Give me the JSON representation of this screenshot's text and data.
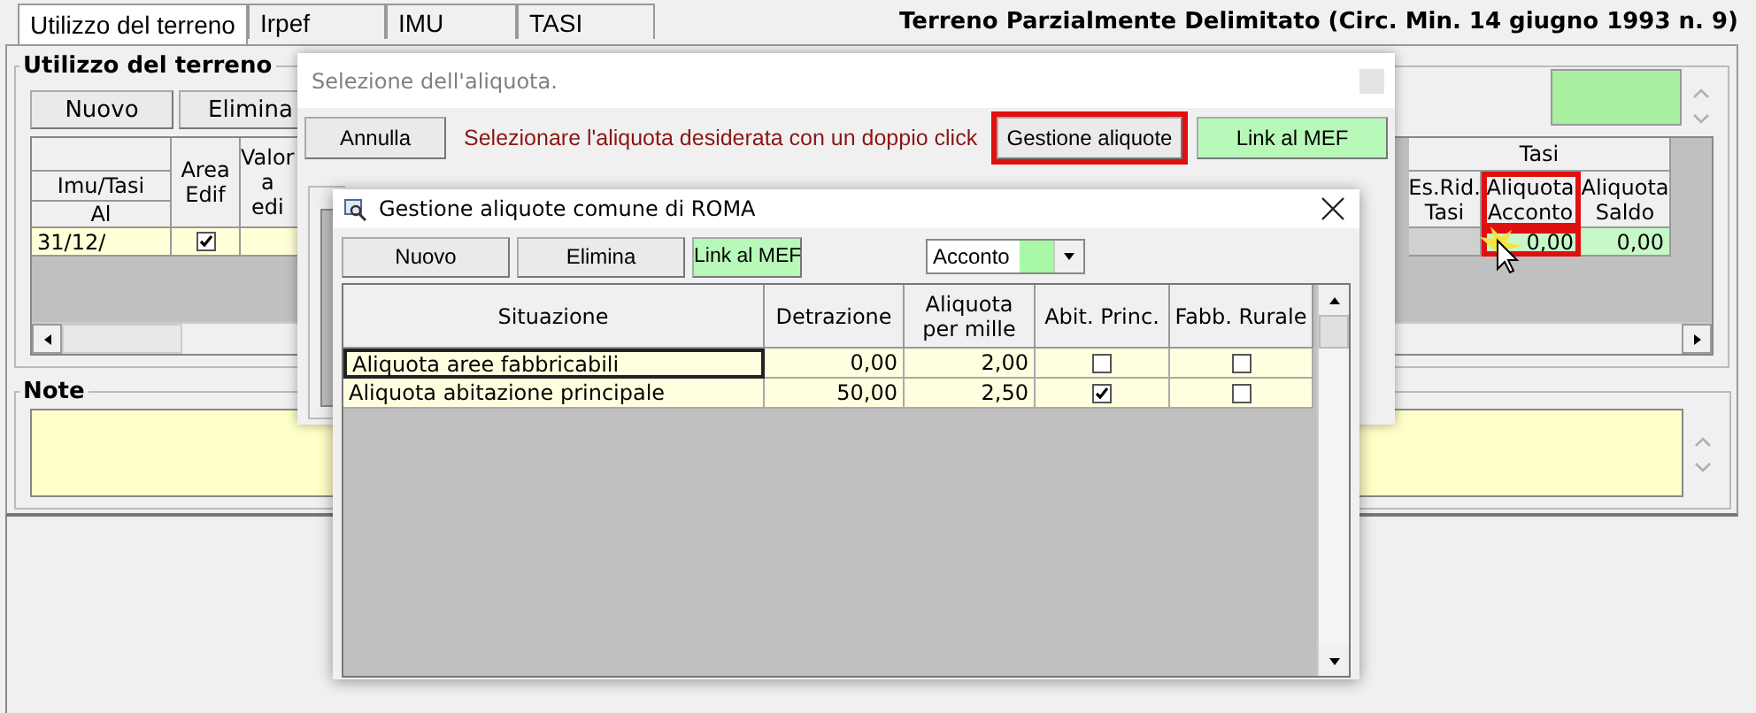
{
  "tabs": [
    {
      "label": "Utilizzo del terreno",
      "selected": true
    },
    {
      "label": "Irpef",
      "selected": false
    },
    {
      "label": "IMU",
      "selected": false
    },
    {
      "label": "TASI",
      "selected": false
    }
  ],
  "header_title": "Terreno Parzialmente Delimitato (Circ. Min. 14 giugno 1993 n. 9)",
  "land_use": {
    "title": "Utilizzo del terreno",
    "buttons": [
      "Nuovo",
      "Elimina"
    ],
    "grid": {
      "imu_tasi": "Imu/Tasi",
      "until": "Al",
      "area_edif": "Area\nEdif",
      "value": "Valor\na\nedi",
      "tasi_group": "Tasi",
      "tasi_columns": [
        {
          "label": "Es.Rid.\nTasi",
          "highlighted": false
        },
        {
          "label": "Aliquota\nAcconto",
          "highlighted": true
        },
        {
          "label": "Aliquota\nSaldo",
          "highlighted": false
        }
      ],
      "rows": [
        {
          "until": "31/12/",
          "area_edif": true,
          "acconto": "0,00",
          "saldo": "0,00"
        }
      ]
    }
  },
  "note": {
    "title": "Note"
  },
  "select_dialog": {
    "title": "Selezione dell'aliquota.",
    "cancel": "Annulla",
    "message": "Selezionare l'aliquota desiderata con un doppio click",
    "actions": [
      {
        "label": "Gestione aliquote",
        "kind": "plain",
        "highlighted": true
      },
      {
        "label": "Link al MEF",
        "kind": "link",
        "highlighted": false
      }
    ]
  },
  "rates_dialog": {
    "title": "Gestione aliquote comune di ROMA",
    "buttons": [
      {
        "label": "Nuovo",
        "kind": "plain"
      },
      {
        "label": "Elimina",
        "kind": "plain"
      },
      {
        "label": "Link al MEF",
        "kind": "link"
      }
    ],
    "period": "Acconto",
    "columns": [
      "Situazione",
      "Detrazione",
      "Aliquota per mille",
      "Abit. Princ.",
      "Fabb. Rurale"
    ],
    "rows": [
      {
        "situazione": "Aliquota aree fabbricabili",
        "detrazione": "0,00",
        "aliquota": "2,00",
        "abit_princ": false,
        "fabb_rurale": false,
        "selected": true
      },
      {
        "situazione": "Aliquota abitazione principale",
        "detrazione": "50,00",
        "aliquota": "2,50",
        "abit_princ": true,
        "fabb_rurale": false,
        "selected": false
      }
    ]
  }
}
